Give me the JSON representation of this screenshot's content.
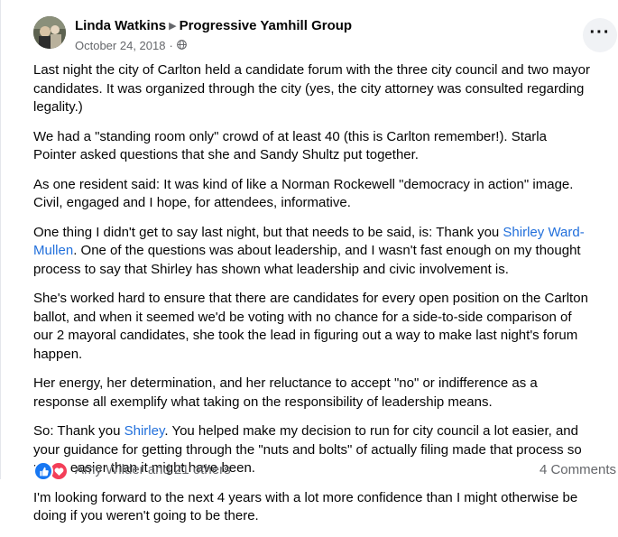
{
  "post": {
    "author": "Linda Watkins",
    "group": "Progressive Yamhill Group",
    "date": "October 24, 2018",
    "dot": "·",
    "privacy_icon": "globe-icon",
    "more_label": "···"
  },
  "body": {
    "p1": "Last night the city of Carlton held a candidate forum with the three city council and two mayor candidates. It was organized through the city (yes, the city attorney was consulted regarding legality.)",
    "p2": "We had a \"standing room only\" crowd of at least 40 (this is Carlton remember!). Starla Pointer asked questions that she and Sandy Shultz put together.",
    "p3": "As one resident said: It was kind of like a Norman Rockewell \"democracy in action\" image. Civil, engaged and I hope, for attendees, informative.",
    "p4_a": "One thing I didn't get to say last night, but that needs to be said, is: Thank you ",
    "p4_link": "Shirley Ward-Mullen",
    "p4_b": ". One of the questions was about leadership, and I wasn't fast enough on my thought process to say that Shirley has shown what leadership and civic involvement is.",
    "p5": "She's worked hard to ensure that there are candidates for every open position on the Carlton ballot, and when it seemed we'd be voting with no chance for a side-to-side comparison of our 2 mayoral candidates, she took the lead in figuring out a way to make last night's forum happen.",
    "p6": "Her energy, her determination, and her reluctance to accept \"no\"  or indifference as a response all exemplify what taking on the responsibility of leadership means.",
    "p7_a": "So: Thank you ",
    "p7_link": "Shirley",
    "p7_b": ". You helped make my decision to run for city council a lot easier, and your guidance for getting through the \"nuts and bolts\" of actually filing made that process so much easier than it might have been.",
    "p8": "I'm looking forward to the next 4 years with a lot more confidence than I might otherwise be doing if you weren't going to be there."
  },
  "footer": {
    "reaction_icons": [
      "like-icon",
      "love-icon"
    ],
    "reactors": "Amy Wilder and 21 others",
    "comments": "4 Comments"
  },
  "colors": {
    "link": "#216fdb",
    "secondary_text": "#65676b",
    "like": "#1877f2",
    "love": "#f33e58"
  }
}
